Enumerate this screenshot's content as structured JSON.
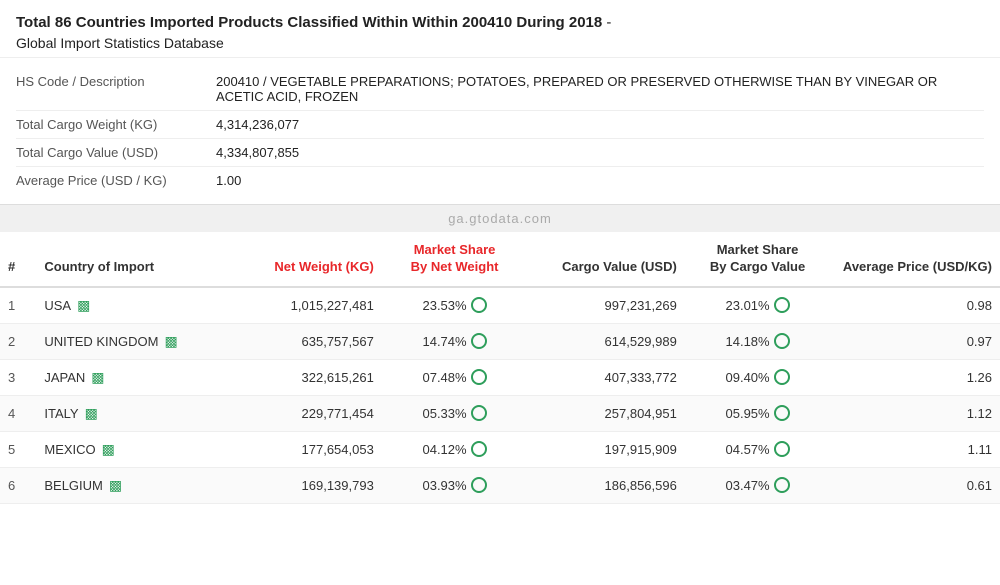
{
  "header": {
    "title_part1": "Total 86 Countries Imported Products Classified Within Within 200410 During 2018",
    "title_part2": "Global Import Statistics Database"
  },
  "info": {
    "fields": [
      {
        "label": "HS Code / Description",
        "value": "200410 / VEGETABLE PREPARATIONS; POTATOES, PREPARED OR PRESERVED OTHERWISE THAN BY VINEGAR OR ACETIC ACID, FROZEN"
      },
      {
        "label": "Total Cargo Weight (KG)",
        "value": "4,314,236,077"
      },
      {
        "label": "Total Cargo Value (USD)",
        "value": "4,334,807,855"
      },
      {
        "label": "Average Price (USD / KG)",
        "value": "1.00"
      }
    ]
  },
  "watermark": "ga.gtodata.com",
  "table": {
    "columns": [
      {
        "id": "rank",
        "label": "#",
        "red": false
      },
      {
        "id": "country",
        "label": "Country of Import",
        "red": false
      },
      {
        "id": "netweight",
        "label": "Net Weight (KG)",
        "red": true
      },
      {
        "id": "marketshare_nw",
        "label": "Market Share\nBy Net Weight",
        "red": true
      },
      {
        "id": "cargovalue",
        "label": "Cargo Value (USD)",
        "red": false
      },
      {
        "id": "marketshare_cv",
        "label": "Market Share\nBy Cargo Value",
        "red": false
      },
      {
        "id": "avgprice",
        "label": "Average Price (USD/KG)",
        "red": false
      }
    ],
    "rows": [
      {
        "rank": 1,
        "country": "USA",
        "netweight": "1,015,227,481",
        "marketshare_nw": "23.53%",
        "cargovalue": "997,231,269",
        "marketshare_cv": "23.01%",
        "avgprice": "0.98"
      },
      {
        "rank": 2,
        "country": "UNITED KINGDOM",
        "netweight": "635,757,567",
        "marketshare_nw": "14.74%",
        "cargovalue": "614,529,989",
        "marketshare_cv": "14.18%",
        "avgprice": "0.97"
      },
      {
        "rank": 3,
        "country": "JAPAN",
        "netweight": "322,615,261",
        "marketshare_nw": "07.48%",
        "cargovalue": "407,333,772",
        "marketshare_cv": "09.40%",
        "avgprice": "1.26"
      },
      {
        "rank": 4,
        "country": "ITALY",
        "netweight": "229,771,454",
        "marketshare_nw": "05.33%",
        "cargovalue": "257,804,951",
        "marketshare_cv": "05.95%",
        "avgprice": "1.12"
      },
      {
        "rank": 5,
        "country": "MEXICO",
        "netweight": "177,654,053",
        "marketshare_nw": "04.12%",
        "cargovalue": "197,915,909",
        "marketshare_cv": "04.57%",
        "avgprice": "1.11"
      },
      {
        "rank": 6,
        "country": "BELGIUM",
        "netweight": "169,139,793",
        "marketshare_nw": "03.93%",
        "cargovalue": "186,856,596",
        "marketshare_cv": "03.47%",
        "avgprice": "0.61"
      }
    ]
  }
}
